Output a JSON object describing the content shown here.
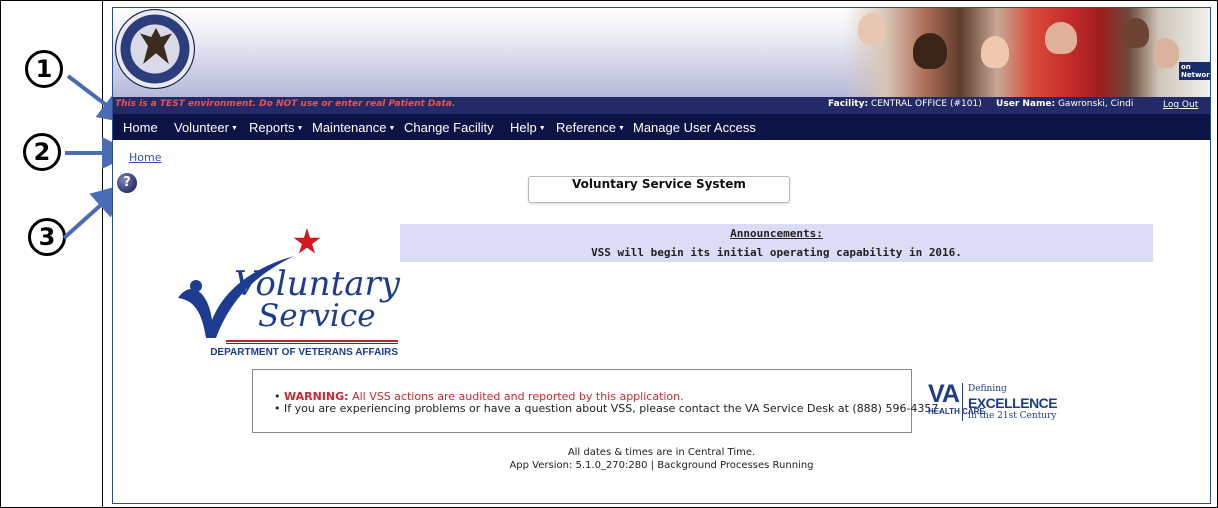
{
  "callouts": [
    "1",
    "2",
    "3"
  ],
  "banner": {
    "test_warning": "This is a TEST environment. Do NOT use or enter real Patient Data.",
    "facility_label": "Facility:",
    "facility_value": "CENTRAL OFFICE (#101)",
    "user_label": "User Name:",
    "user_value": "Gawronski, Cindi",
    "logout_label": "Log Out",
    "bus_sign": "on Network"
  },
  "menu": [
    {
      "label": "Home",
      "has_dropdown": false
    },
    {
      "label": "Volunteer",
      "has_dropdown": true
    },
    {
      "label": "Reports",
      "has_dropdown": true
    },
    {
      "label": "Maintenance",
      "has_dropdown": true
    },
    {
      "label": "Change Facility",
      "has_dropdown": false
    },
    {
      "label": "Help",
      "has_dropdown": true
    },
    {
      "label": "Reference",
      "has_dropdown": true
    },
    {
      "label": "Manage User Access",
      "has_dropdown": false
    }
  ],
  "breadcrumb": "Home",
  "help_icon": {
    "glyph": "?",
    "icon": "help-icon"
  },
  "system_title": "Voluntary Service System",
  "announcements": {
    "title": "Announcements:",
    "text": "VSS will begin its initial operating capability in 2016."
  },
  "vs_logo": {
    "line1": "Voluntary",
    "line2": "Service",
    "department": "DEPARTMENT OF VETERANS AFFAIRS"
  },
  "notice": {
    "warning_label": "WARNING:",
    "warning_text": "All VSS actions are audited and reported by this application.",
    "help_text": "If you are experiencing problems or have a question about VSS, please contact the VA Service Desk at (888) 596-4357."
  },
  "va_logo": {
    "letters": "VA",
    "health_care": "HEALTH CARE",
    "defining": "Defining",
    "excellence": "EXCELLENCE",
    "century": "in the 21st Century"
  },
  "footer": {
    "dates": "All dates & times are in Central Time.",
    "version": "App Version: 5.1.0_270:280 | Background Processes Running"
  },
  "colors": {
    "nav_bg": "#0b1445",
    "test_strip_bg": "#242a68",
    "warning_red": "#d0272e",
    "announcement_bg": "#dcdcf6",
    "brand_blue": "#1e3c8f"
  }
}
